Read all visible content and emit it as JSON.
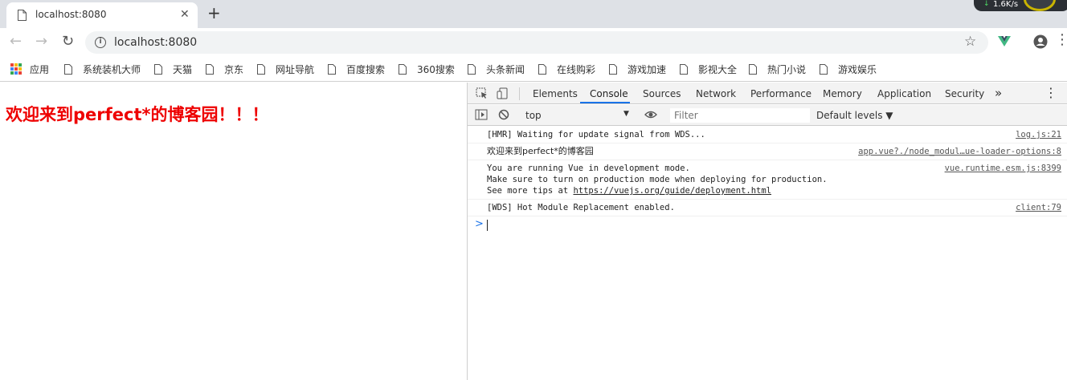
{
  "tab": {
    "title": "localhost:8080"
  },
  "network_widget": {
    "speed": "1.6K/s"
  },
  "address_bar": {
    "url": "localhost:8080"
  },
  "bookmarks": [
    {
      "label": "应用",
      "icon": "apps-grid-icon"
    },
    {
      "label": "系统装机大师",
      "icon": "page-icon"
    },
    {
      "label": "天猫",
      "icon": "page-icon"
    },
    {
      "label": "京东",
      "icon": "page-icon"
    },
    {
      "label": "网址导航",
      "icon": "page-icon"
    },
    {
      "label": "百度搜索",
      "icon": "page-icon"
    },
    {
      "label": "360搜索",
      "icon": "page-icon"
    },
    {
      "label": "头条新闻",
      "icon": "page-icon"
    },
    {
      "label": "在线购彩",
      "icon": "page-icon"
    },
    {
      "label": "游戏加速",
      "icon": "page-icon"
    },
    {
      "label": "影视大全",
      "icon": "page-icon"
    },
    {
      "label": "热门小说",
      "icon": "page-icon"
    },
    {
      "label": "游戏娱乐",
      "icon": "page-icon"
    }
  ],
  "page": {
    "heading": "欢迎来到perfect*的博客园！！！",
    "heading_color": "#ee0000"
  },
  "devtools": {
    "tabs": [
      "Elements",
      "Console",
      "Sources",
      "Network",
      "Performance",
      "Memory",
      "Application",
      "Security"
    ],
    "active_tab": "Console",
    "more_tabs": "»",
    "context": "top",
    "filter_placeholder": "Filter",
    "levels": "Default levels ▼",
    "messages": [
      {
        "lines": [
          "[HMR] Waiting for update signal from WDS..."
        ],
        "source": "log.js:21"
      },
      {
        "lines": [
          "欢迎来到perfect*的博客园"
        ],
        "source": "app.vue?./node_modul…ue-loader-options:8"
      },
      {
        "lines": [
          "You are running Vue in development mode.",
          "Make sure to turn on production mode when deploying for production.",
          "See more tips at "
        ],
        "link": "https://vuejs.org/guide/deployment.html",
        "source": "vue.runtime.esm.js:8399"
      },
      {
        "lines": [
          "[WDS] Hot Module Replacement enabled."
        ],
        "source": "client:79"
      }
    ],
    "prompt": ">"
  }
}
